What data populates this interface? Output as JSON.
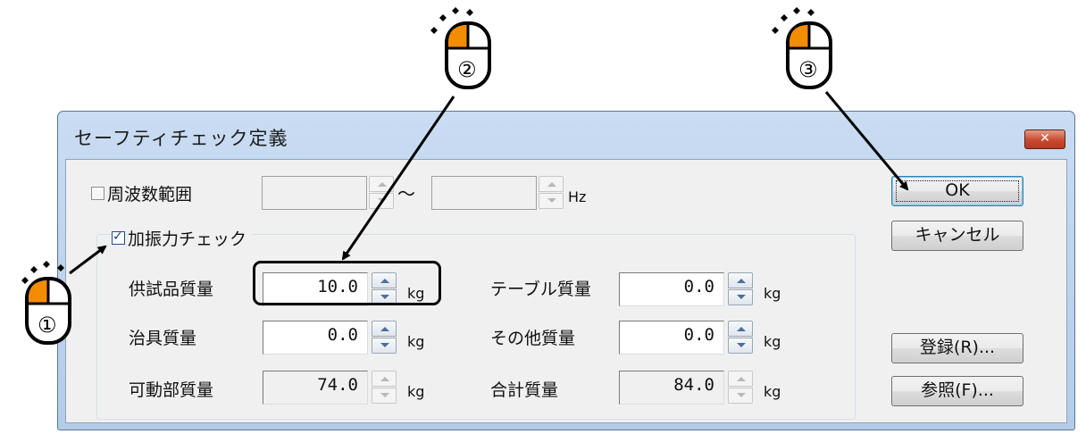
{
  "dialog": {
    "title": "セーフティチェック定義",
    "close_glyph": "✕"
  },
  "frequency": {
    "label": "周波数範囲",
    "checked": false,
    "from_value": "",
    "to_value": "",
    "tilde": "～",
    "unit": "Hz"
  },
  "force_check": {
    "label": "加振力チェック",
    "checked": true,
    "fields": {
      "specimen_mass": {
        "label": "供試品質量",
        "value": "10.0",
        "unit": "kg"
      },
      "table_mass": {
        "label": "テーブル質量",
        "value": "0.0",
        "unit": "kg"
      },
      "fixture_mass": {
        "label": "治具質量",
        "value": "0.0",
        "unit": "kg"
      },
      "other_mass": {
        "label": "その他質量",
        "value": "0.0",
        "unit": "kg"
      },
      "moving_mass": {
        "label": "可動部質量",
        "value": "74.0",
        "unit": "kg"
      },
      "total_mass": {
        "label": "合計質量",
        "value": "84.0",
        "unit": "kg"
      }
    }
  },
  "buttons": {
    "ok": "OK",
    "cancel": "キャンセル",
    "register": "登録(R)...",
    "reference": "参照(F)..."
  },
  "annotations": {
    "step1": "①",
    "step2": "②",
    "step3": "③",
    "accent_color": "#f28c00"
  }
}
